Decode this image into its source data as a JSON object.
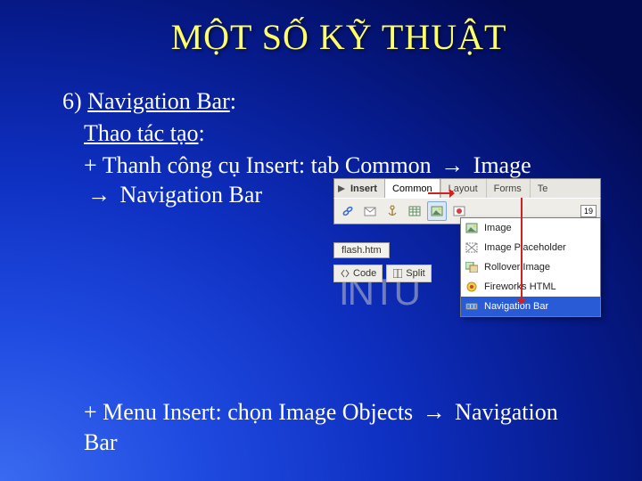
{
  "title": "MỘT SỐ KỸ THUẬT",
  "item6_prefix": "6) ",
  "item6_label": "Navigation Bar",
  "item6_colon": ":",
  "sub_label": "Thao tác tạo",
  "sub_colon": ":",
  "plus1_a": "+ Thanh công cụ Insert: tab Common ",
  "plus1_b": " Image",
  "plus1_c": " Navigation Bar",
  "arrow": "→",
  "insert_panel": {
    "title": "Insert",
    "tabs": [
      "Common",
      "Layout",
      "Forms",
      "Te"
    ],
    "toolbar_badge": "19"
  },
  "filetab": "flash.htm",
  "viewbtns": [
    "Code",
    "Split"
  ],
  "dropdown": {
    "items": [
      "Image",
      "Image Placeholder",
      "Rollover Image",
      "Fireworks HTML",
      "Navigation Bar"
    ],
    "selected_index": 4
  },
  "ghost_text": "INTU",
  "plus2_a": "+ Menu Insert: chọn Image Objects ",
  "plus2_b": "Navigation Bar"
}
